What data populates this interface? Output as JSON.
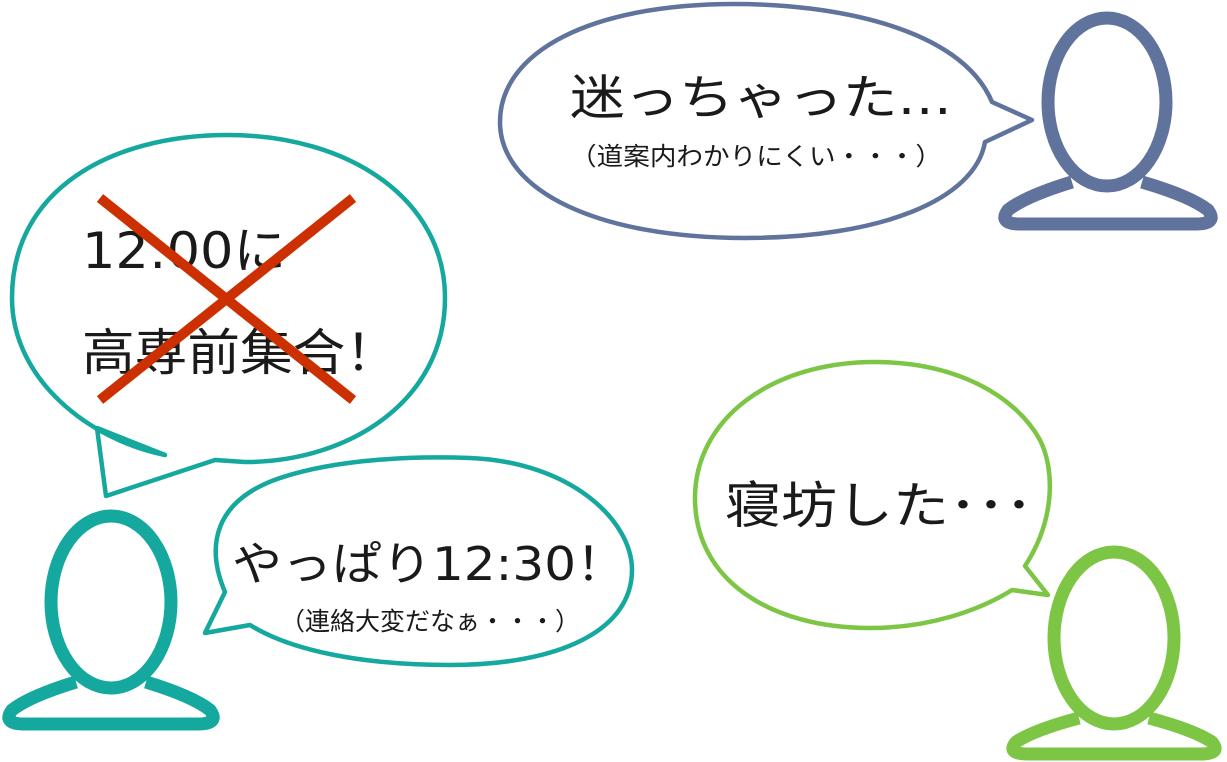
{
  "colors": {
    "blue_person": "#5f739c",
    "teal_person": "#14a89e",
    "green_person": "#7cc545",
    "cross_mark": "#cc2f00",
    "text": "#1a1a1a"
  },
  "bubbles": {
    "lost": {
      "main": "迷っちゃった…",
      "sub": "（道案内わかりにくい・・・）"
    },
    "meeting": {
      "line1": "12:00に",
      "line2": "高専前集合！"
    },
    "change": {
      "main": "やっぱり12:30！",
      "sub": "（連絡大変だなぁ・・・）"
    },
    "overslept": {
      "main": "寝坊した･･･"
    }
  },
  "icons": {
    "blue": "person-icon",
    "teal": "person-icon",
    "green": "person-icon",
    "cross": "cross-mark-icon"
  }
}
